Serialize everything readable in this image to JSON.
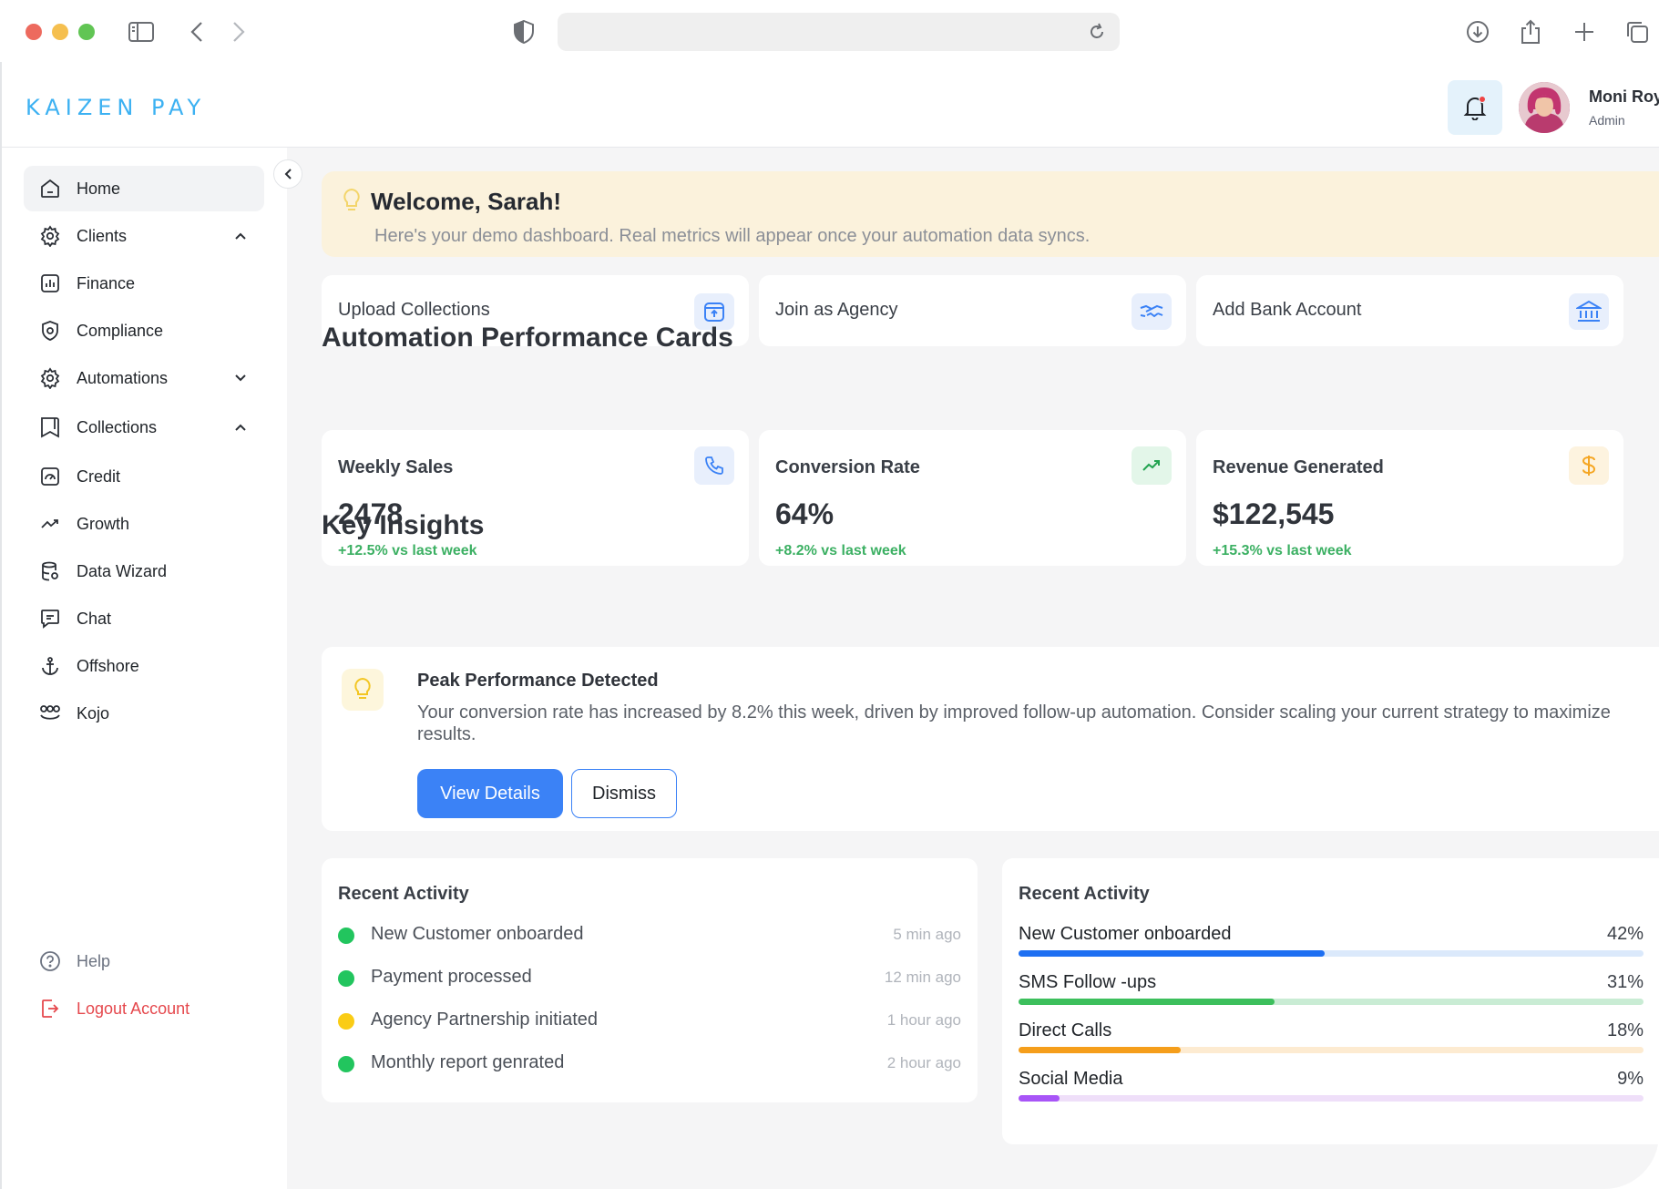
{
  "brand": "KAIZEN PAY",
  "user": {
    "name": "Moni Roy",
    "role": "Admin"
  },
  "sidebar": {
    "items": [
      {
        "label": "Home",
        "icon": "home-icon"
      },
      {
        "label": "Clients",
        "icon": "gear-icon",
        "chevron": "up"
      },
      {
        "label": "Finance",
        "icon": "chart-icon"
      },
      {
        "label": "Compliance",
        "icon": "shield-icon"
      },
      {
        "label": "Automations",
        "icon": "gear-icon",
        "chevron": "down"
      },
      {
        "label": "Collections",
        "icon": "bookmark-icon",
        "chevron": "up"
      },
      {
        "label": "Credit",
        "icon": "credit-icon"
      },
      {
        "label": "Growth",
        "icon": "trend-icon"
      },
      {
        "label": "Data Wizard",
        "icon": "database-icon"
      },
      {
        "label": "Chat",
        "icon": "chat-icon"
      },
      {
        "label": "Offshore",
        "icon": "anchor-icon"
      },
      {
        "label": "Kojo",
        "icon": "kojo-icon"
      }
    ],
    "help": "Help",
    "logout": "Logout Account"
  },
  "welcome": {
    "title": "Welcome, Sarah!",
    "subtitle": "Here's your demo dashboard. Real metrics will appear once your automation data syncs."
  },
  "actions": [
    {
      "label": "Upload Collections",
      "icon": "upload-icon"
    },
    {
      "label": "Join as Agency",
      "icon": "handshake-icon"
    },
    {
      "label": "Add Bank Account",
      "icon": "bank-icon"
    }
  ],
  "performance": {
    "title": "Automation Performance Cards",
    "cards": [
      {
        "label": "Weekly Sales",
        "value": "2478",
        "change": "+12.5% vs last week",
        "icon": "phone-icon",
        "icon_bg": "#e8effc",
        "icon_color": "#3b82f6"
      },
      {
        "label": "Conversion Rate",
        "value": "64%",
        "change": "+8.2% vs last week",
        "icon": "trend-up-icon",
        "icon_bg": "#e3f6e9",
        "icon_color": "#22a350"
      },
      {
        "label": "Revenue Generated",
        "value": "$122,545",
        "change": "+15.3% vs last week",
        "icon": "dollar-icon",
        "icon_bg": "#fdf3df",
        "icon_color": "#f5a623"
      }
    ]
  },
  "insights": {
    "title": "Key Insights",
    "card": {
      "title": "Peak Performance Detected",
      "body": "Your conversion rate has increased by 8.2% this week, driven by improved follow-up automation. Consider scaling your current strategy to maximize results.",
      "primary_button": "View Details",
      "secondary_button": "Dismiss"
    }
  },
  "recent_activity": {
    "title": "Recent Activity",
    "items": [
      {
        "label": "New Customer onboarded",
        "time": "5 min ago",
        "color": "#22c55e"
      },
      {
        "label": "Payment processed",
        "time": "12 min ago",
        "color": "#22c55e"
      },
      {
        "label": "Agency Partnership initiated",
        "time": "1 hour ago",
        "color": "#facc15"
      },
      {
        "label": "Monthly report genrated",
        "time": "2 hour ago",
        "color": "#22c55e"
      }
    ]
  },
  "activity_breakdown": {
    "title": "Recent Activity",
    "items": [
      {
        "label": "New Customer onboarded",
        "value_text": "42%",
        "percent": 49,
        "color": "#1d6ff2",
        "track": "#dbe9fb"
      },
      {
        "label": "SMS Follow -ups",
        "value_text": "31%",
        "percent": 41,
        "color": "#3cbf5c",
        "track": "#c9ecd4"
      },
      {
        "label": "Direct Calls",
        "value_text": "18%",
        "percent": 26,
        "color": "#f59e1b",
        "track": "#fdebd1"
      },
      {
        "label": "Social Media",
        "value_text": "9%",
        "percent": 6.5,
        "color": "#a855f7",
        "track": "#efdff9"
      }
    ]
  }
}
